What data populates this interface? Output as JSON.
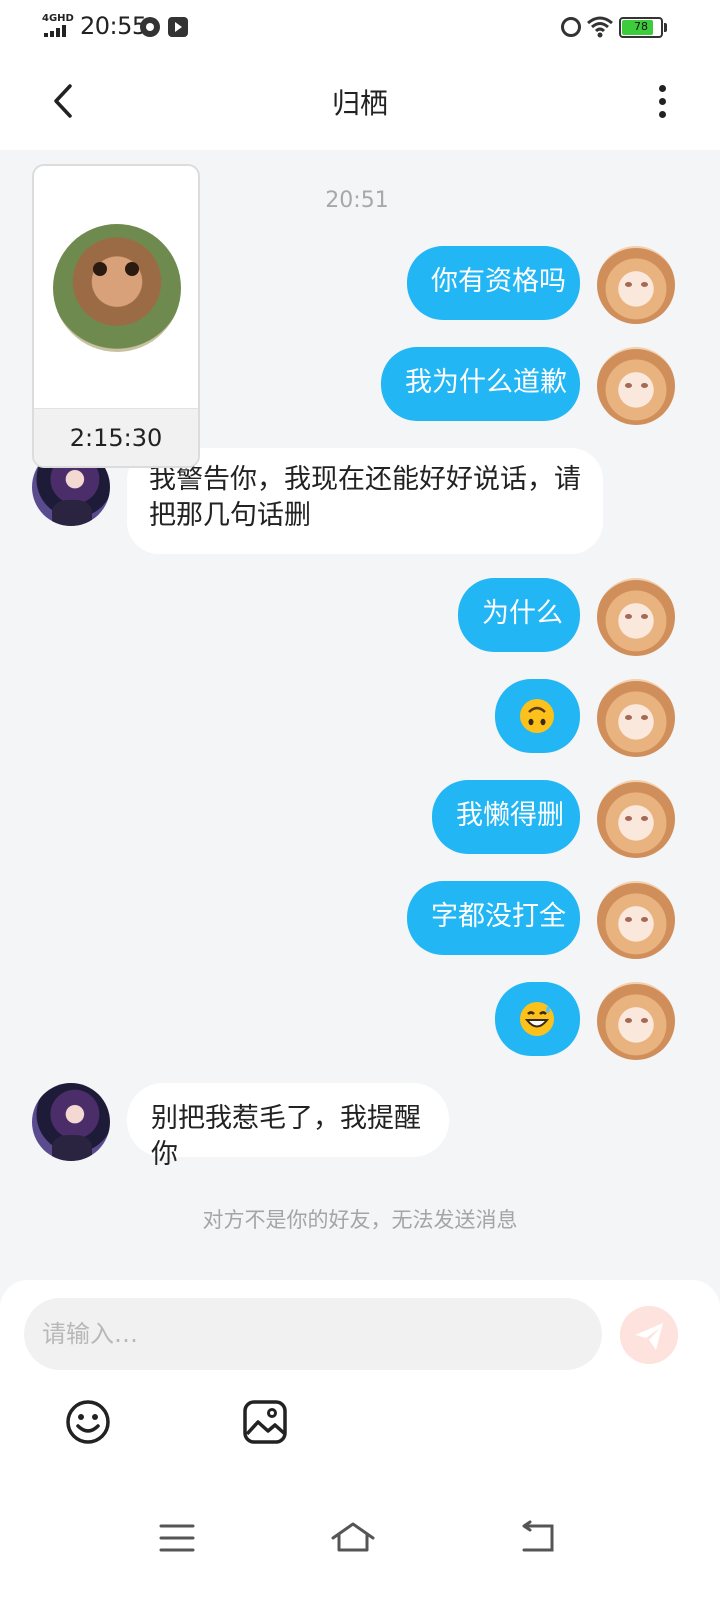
{
  "status_bar": {
    "network": "4GHD",
    "time": "20:55",
    "battery_level": "78"
  },
  "header": {
    "title": "归栖"
  },
  "chat": {
    "timestamp": "20:51",
    "messages": [
      {
        "sender": "me",
        "text": "你有资格吗"
      },
      {
        "sender": "me",
        "text": "我为什么道歉"
      },
      {
        "sender": "other",
        "text": "我警告你，我现在还能好好说话，请把那几句话删"
      },
      {
        "sender": "me",
        "text": "为什么"
      },
      {
        "sender": "me",
        "emoji": "upside-down-face-emoji"
      },
      {
        "sender": "me",
        "text": "我懒得删"
      },
      {
        "sender": "me",
        "text": "字都没打全"
      },
      {
        "sender": "me",
        "emoji": "grinning-sweat-face-emoji"
      },
      {
        "sender": "other",
        "text": "别把我惹毛了，我提醒你"
      }
    ],
    "notice": "对方不是你的好友，无法发送消息"
  },
  "floating_video": {
    "duration": "2:15:30"
  },
  "input": {
    "placeholder": "请输入…",
    "send_icon": "send-icon",
    "emoji_button_icon": "smiley-icon",
    "image_button_icon": "image-icon"
  },
  "nav": {
    "menu_icon": "menu-icon",
    "home_icon": "home-icon",
    "back_icon": "back-icon"
  },
  "colors": {
    "my_bubble": "#23b6f4",
    "other_bubble": "#ffffff",
    "background": "#f4f5f7",
    "send_button_disabled": "#fde2dd"
  }
}
